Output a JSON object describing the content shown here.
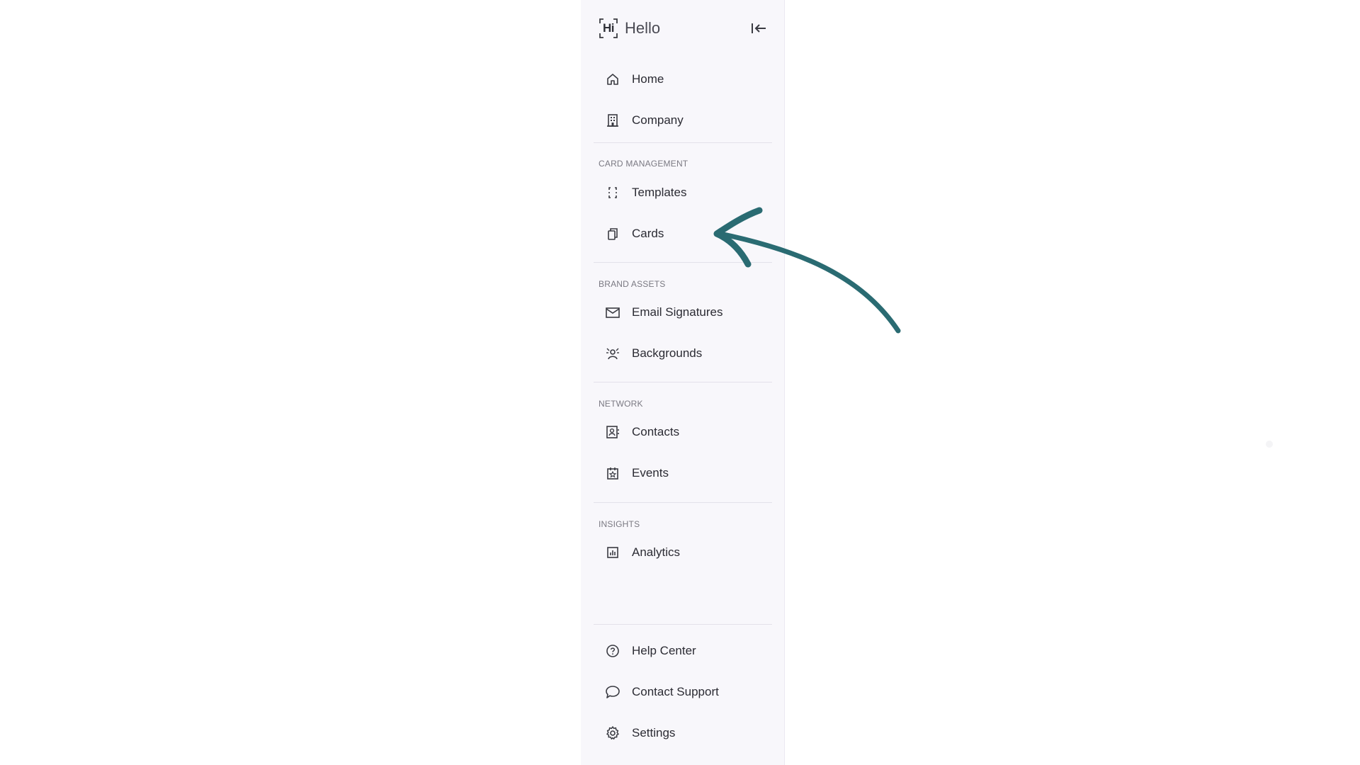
{
  "brand": {
    "mark": "Hi",
    "name": "Hello"
  },
  "colors": {
    "sidebar_bg": "#f8f7fb",
    "text": "#2b2b33",
    "section_title": "#7a7982",
    "arrow": "#2a6b72"
  },
  "nav": {
    "main": [
      {
        "label": "Home",
        "icon": "home-icon"
      },
      {
        "label": "Company",
        "icon": "building-icon"
      }
    ],
    "sections": [
      {
        "title": "CARD MANAGEMENT",
        "items": [
          {
            "label": "Templates",
            "icon": "dashed-frame-icon"
          },
          {
            "label": "Cards",
            "icon": "cards-icon"
          }
        ]
      },
      {
        "title": "BRAND ASSETS",
        "items": [
          {
            "label": "Email Signatures",
            "icon": "mail-icon"
          },
          {
            "label": "Backgrounds",
            "icon": "background-person-icon"
          }
        ]
      },
      {
        "title": "NETWORK",
        "items": [
          {
            "label": "Contacts",
            "icon": "contact-book-icon"
          },
          {
            "label": "Events",
            "icon": "calendar-star-icon"
          }
        ]
      },
      {
        "title": "INSIGHTS",
        "items": [
          {
            "label": "Analytics",
            "icon": "bar-chart-icon"
          }
        ]
      }
    ],
    "footer": [
      {
        "label": "Help Center",
        "icon": "help-circle-icon"
      },
      {
        "label": "Contact Support",
        "icon": "chat-bubble-icon"
      },
      {
        "label": "Settings",
        "icon": "gear-icon"
      }
    ]
  }
}
